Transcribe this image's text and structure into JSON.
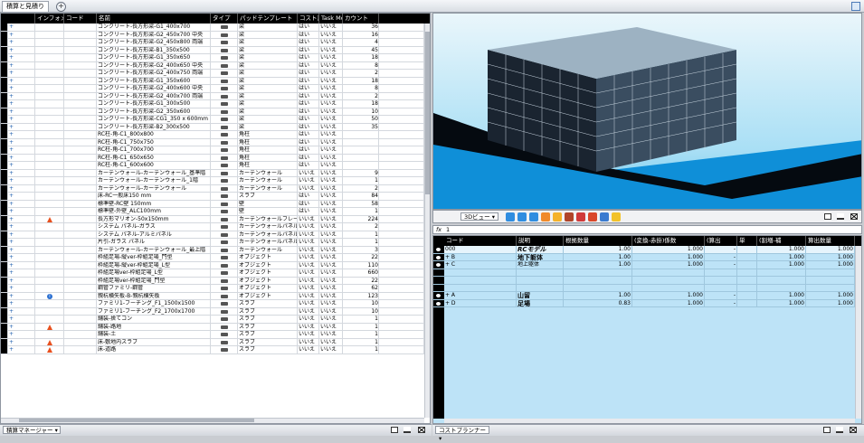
{
  "tab": {
    "title": "積算と見積り",
    "add": "+"
  },
  "left": {
    "headers": [
      "",
      "インフォメーション",
      "コード",
      "名前",
      "タイプ",
      "パッドテンプレート",
      "コスト計",
      "Task Mode",
      "カウント"
    ],
    "rows": [
      {
        "name": "コンクリート-長方形梁-G1_400x700",
        "type": "梁",
        "cost": "はい",
        "task": "いいえ",
        "count": "36"
      },
      {
        "name": "コンクリート-長方形梁-G2_450x700 中央",
        "type": "梁",
        "cost": "はい",
        "task": "いいえ",
        "count": "16"
      },
      {
        "name": "コンクリート-長方形梁-G2_450x800 両端",
        "type": "梁",
        "cost": "はい",
        "task": "いいえ",
        "count": "4"
      },
      {
        "name": "コンクリート-長方形梁-B1_350x500",
        "type": "梁",
        "cost": "はい",
        "task": "いいえ",
        "count": "45"
      },
      {
        "name": "コンクリート-長方形梁-G1_350x650",
        "type": "梁",
        "cost": "はい",
        "task": "いいえ",
        "count": "18"
      },
      {
        "name": "コンクリート-長方形梁-G2_400x650 中央",
        "type": "梁",
        "cost": "はい",
        "task": "いいえ",
        "count": "8"
      },
      {
        "name": "コンクリート-長方形梁-G2_400x750 両端",
        "type": "梁",
        "cost": "はい",
        "task": "いいえ",
        "count": "2"
      },
      {
        "name": "コンクリート-長方形梁-G1_350x600",
        "type": "梁",
        "cost": "はい",
        "task": "いいえ",
        "count": "18"
      },
      {
        "name": "コンクリート-長方形梁-G2_400x600 中央",
        "type": "梁",
        "cost": "はい",
        "task": "いいえ",
        "count": "8"
      },
      {
        "name": "コンクリート-長方形梁-G2_400x700 両端",
        "type": "梁",
        "cost": "はい",
        "task": "いいえ",
        "count": "2"
      },
      {
        "name": "コンクリート-長方形梁-G1_300x500",
        "type": "梁",
        "cost": "はい",
        "task": "いいえ",
        "count": "18"
      },
      {
        "name": "コンクリート-長方形梁-G2_350x600",
        "type": "梁",
        "cost": "はい",
        "task": "いいえ",
        "count": "10"
      },
      {
        "name": "コンクリート-長方形梁-CG1_350 x 600mm",
        "type": "梁",
        "cost": "はい",
        "task": "いいえ",
        "count": "50"
      },
      {
        "name": "コンクリート-長方形梁-B2_300x500",
        "type": "梁",
        "cost": "はい",
        "task": "いいえ",
        "count": "35"
      },
      {
        "name": "RC柱-角-C1_800x800",
        "type": "角柱",
        "cost": "はい",
        "task": "いいえ",
        "count": ""
      },
      {
        "name": "RC柱-角-C1_750x750",
        "type": "角柱",
        "cost": "はい",
        "task": "いいえ",
        "count": ""
      },
      {
        "name": "RC柱-角-C1_700x700",
        "type": "角柱",
        "cost": "はい",
        "task": "いいえ",
        "count": ""
      },
      {
        "name": "RC柱-角-C1_650x650",
        "type": "角柱",
        "cost": "はい",
        "task": "いいえ",
        "count": ""
      },
      {
        "name": "RC柱-角-C1_600x600",
        "type": "角柱",
        "cost": "はい",
        "task": "いいえ",
        "count": ""
      },
      {
        "name": "カーテンウォール-カーテンウォール_基準階",
        "type": "カーテンウォール",
        "cost": "いいえ",
        "task": "いいえ",
        "count": "9"
      },
      {
        "name": "カーテンウォール-カーテンウォール_1階",
        "type": "カーテンウォール",
        "cost": "いいえ",
        "task": "いいえ",
        "count": "1"
      },
      {
        "name": "カーテンウォール-カーテンウォール",
        "type": "カーテンウォール",
        "cost": "いいえ",
        "task": "いいえ",
        "count": "2"
      },
      {
        "name": "床-RC一般床150 mm",
        "type": "スラブ",
        "cost": "はい",
        "task": "いいえ",
        "count": "84"
      },
      {
        "name": "標準壁-RC壁 150mm",
        "type": "壁",
        "cost": "はい",
        "task": "いいえ",
        "count": "58"
      },
      {
        "name": "標準壁-外壁_ALC100mm",
        "type": "壁",
        "cost": "はい",
        "task": "いいえ",
        "count": "1"
      },
      {
        "name": "長方形マリオン-50x150mm",
        "type": "カーテンウォールフレーム",
        "cost": "いいえ",
        "task": "いいえ",
        "count": "224"
      },
      {
        "name": "システム パネル-ガラス",
        "type": "カーテンウォールパネル",
        "cost": "いいえ",
        "task": "いいえ",
        "count": "2"
      },
      {
        "name": "システム パネル-アルミパネル",
        "type": "カーテンウォールパネル",
        "cost": "いいえ",
        "task": "いいえ",
        "count": "1"
      },
      {
        "name": "片引-ガラス パネル",
        "type": "カーテンウォールパネル",
        "cost": "いいえ",
        "task": "いいえ",
        "count": "1"
      },
      {
        "name": "カーテンウォール-カーテンウォール_最上階",
        "type": "カーテンウォール",
        "cost": "いいえ",
        "task": "いいえ",
        "count": "3"
      },
      {
        "name": "枠組足場-縦ver-枠組足場_門型",
        "type": "オブジェクト",
        "cost": "いいえ",
        "task": "いいえ",
        "count": "22"
      },
      {
        "name": "枠組足場-縦ver-枠組足場_L型",
        "type": "オブジェクト",
        "cost": "いいえ",
        "task": "いいえ",
        "count": "110"
      },
      {
        "name": "枠組足場ver-枠組足場_L型",
        "type": "オブジェクト",
        "cost": "いいえ",
        "task": "いいえ",
        "count": "660"
      },
      {
        "name": "枠組足場ver-枠組足場_門型",
        "type": "オブジェクト",
        "cost": "いいえ",
        "task": "いいえ",
        "count": "22"
      },
      {
        "name": "鋼管ファミリ-鋼管",
        "type": "オブジェクト",
        "cost": "いいえ",
        "task": "いいえ",
        "count": "62"
      },
      {
        "name": "親杭横矢板-B-親杭横矢板",
        "type": "オブジェクト",
        "cost": "いいえ",
        "task": "いいえ",
        "count": "123"
      },
      {
        "name": "ファミリ1-フーチング_F1_1500x1500",
        "type": "スラブ",
        "cost": "いいえ",
        "task": "いいえ",
        "count": "10"
      },
      {
        "name": "ファミリ1-フーチング_F2_1700x1700",
        "type": "スラブ",
        "cost": "いいえ",
        "task": "いいえ",
        "count": "10"
      },
      {
        "name": "舗装-捨てコン",
        "type": "スラブ",
        "cost": "いいえ",
        "task": "いいえ",
        "count": "1"
      },
      {
        "name": "舗装-路地",
        "type": "スラブ",
        "cost": "いいえ",
        "task": "いいえ",
        "count": "1"
      },
      {
        "name": "舗装-土",
        "type": "スラブ",
        "cost": "いいえ",
        "task": "いいえ",
        "count": "1"
      },
      {
        "name": "床-敷地内スラブ",
        "type": "スラブ",
        "cost": "いいえ",
        "task": "いいえ",
        "count": "1"
      },
      {
        "name": "床-道路",
        "type": "スラブ",
        "cost": "いいえ",
        "task": "いいえ",
        "count": "1"
      }
    ],
    "footer_combo": "積算マネージャー"
  },
  "view3d": {
    "mode": "3Dビュー"
  },
  "fx": {
    "label": "fx",
    "value": "1"
  },
  "cost": {
    "headers": [
      "コード",
      "説明",
      "根拠数量",
      "(変換-赤掛)係数",
      "(算出",
      "単",
      "(割増-補",
      "算出数量"
    ],
    "rows": [
      {
        "code": "000",
        "desc": "RCモデル",
        "q": "1.00",
        "f": "1.000",
        "s": "-",
        "u": "",
        "w": "1.000",
        "c": "1.000",
        "bold": true,
        "sel": true
      },
      {
        "code": "B",
        "desc": "地下躯体",
        "q": "1.00",
        "f": "1.000",
        "s": "-",
        "u": "",
        "w": "1.000",
        "c": "1.000",
        "bold": true
      },
      {
        "code": "C",
        "desc": "地上躯体",
        "q": "1.00",
        "f": "1.000",
        "s": "-",
        "u": "",
        "w": "1.000",
        "c": "1.000"
      },
      {
        "code": "",
        "desc": "",
        "q": "",
        "f": "",
        "s": "",
        "u": "",
        "w": "",
        "c": ""
      },
      {
        "code": "",
        "desc": "",
        "q": "",
        "f": "",
        "s": "",
        "u": "",
        "w": "",
        "c": ""
      },
      {
        "code": "",
        "desc": "",
        "q": "",
        "f": "",
        "s": "",
        "u": "",
        "w": "",
        "c": ""
      },
      {
        "code": "A",
        "desc": "山留",
        "q": "1.00",
        "f": "1.000",
        "s": "-",
        "u": "",
        "w": "1.000",
        "c": "1.000",
        "bold": true
      },
      {
        "code": "D",
        "desc": "足場",
        "q": "0.83",
        "f": "1.000",
        "s": "-",
        "u": "",
        "w": "1.000",
        "c": "1.000",
        "bold": true
      }
    ],
    "footer_combo": "コストプランナー"
  }
}
